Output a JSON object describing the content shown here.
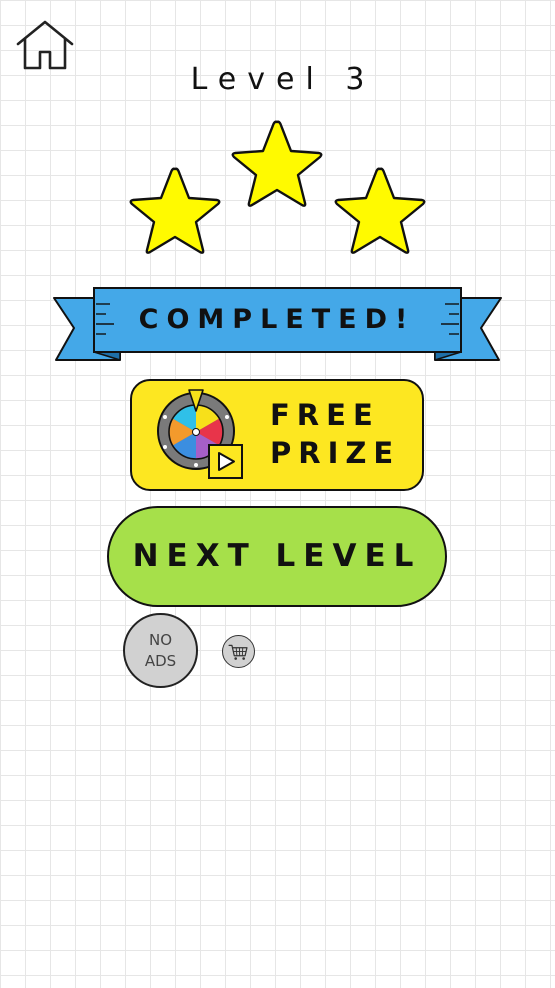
{
  "header": {
    "home_icon": "home-icon",
    "level_title": "Level 3"
  },
  "stars": {
    "earned": 3,
    "total": 3,
    "color": "#fffa00"
  },
  "banner": {
    "text": "COMPLETED!",
    "color": "#44a8e8"
  },
  "prize_button": {
    "line1": "FREE",
    "line2": "PRIZE",
    "icon": "prize-wheel-icon",
    "badge_icon": "play-video-icon",
    "color": "#fde721"
  },
  "next_button": {
    "label": "NEXT LEVEL",
    "color": "#a6e04a"
  },
  "no_ads_button": {
    "line1": "NO",
    "line2": "ADS"
  },
  "shop_button": {
    "icon": "shopping-cart-icon"
  }
}
